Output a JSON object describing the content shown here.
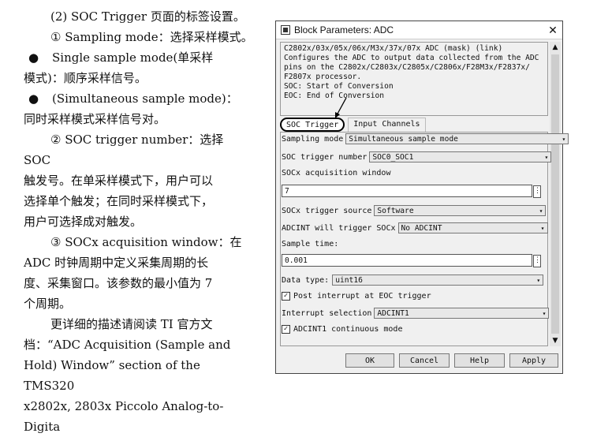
{
  "doc": {
    "lines": [
      "(2) SOC Trigger 页面的标签设置。",
      "① Sampling mode：选择采样模式。",
      "Single sample mode(单采样",
      "模式)：顺序采样信号。",
      "(Simultaneous sample mode)：",
      "同时采样模式采样信号对。",
      "② SOC trigger number：选择 SOC",
      "触发号。在单采样模式下，用户可以",
      "选择单个触发；在同时采样模式下，",
      "用户可选择成对触发。",
      "③ SOCx acquisition window：在",
      "ADC 时钟周期中定义采集周期的长",
      "度、采集窗口。该参数的最小值为 7",
      "个周期。",
      "更详细的描述请阅读 TI 官方文",
      "档：“ADC Acquisition (Sample and",
      "Hold) Window” section of the TMS320",
      "x2802x, 2803x Piccolo Analog-to-Digita"
    ],
    "bullet": "●"
  },
  "dialog": {
    "title": "Block Parameters: ADC",
    "close": "✕",
    "desc_lines": [
      "C2802x/03x/05x/06x/M3x/37x/07x ADC (mask) (link)",
      "Configures the ADC to output data collected from the ADC",
      "pins on the C2802x/C2803x/C2805x/C2806x/F28M3x/F2837x/",
      "F2807x processor.",
      "SOC: Start of Conversion",
      "EOC: End of Conversion"
    ],
    "tabs": [
      "SOC Trigger",
      "Input Channels"
    ],
    "sampling_mode_label": "Sampling mode",
    "sampling_mode_value": "Simultaneous sample mode",
    "soc_trigger_number_label": "SOC trigger number",
    "soc_trigger_number_value": "SOC0_SOC1",
    "acq_window_label": "SOCx acquisition window",
    "acq_window_value": "7",
    "trigger_source_label": "SOCx trigger source",
    "trigger_source_value": "Software",
    "adcint_label": "ADCINT will trigger SOCx",
    "adcint_value": "No ADCINT",
    "sample_time_label": "Sample time:",
    "sample_time_value": "0.001",
    "data_type_label": "Data type:",
    "data_type_value": "uint16",
    "post_int_label": "Post interrupt at EOC trigger",
    "int_sel_label": "Interrupt selection",
    "int_sel_value": "ADCINT1",
    "cont_mode_label": "ADCINT1 continuous mode",
    "more": "⋮",
    "dropdown": "▾",
    "check": "✓",
    "scroll_up": "▲",
    "scroll_down": "▼",
    "buttons": [
      "OK",
      "Cancel",
      "Help",
      "Apply"
    ]
  }
}
